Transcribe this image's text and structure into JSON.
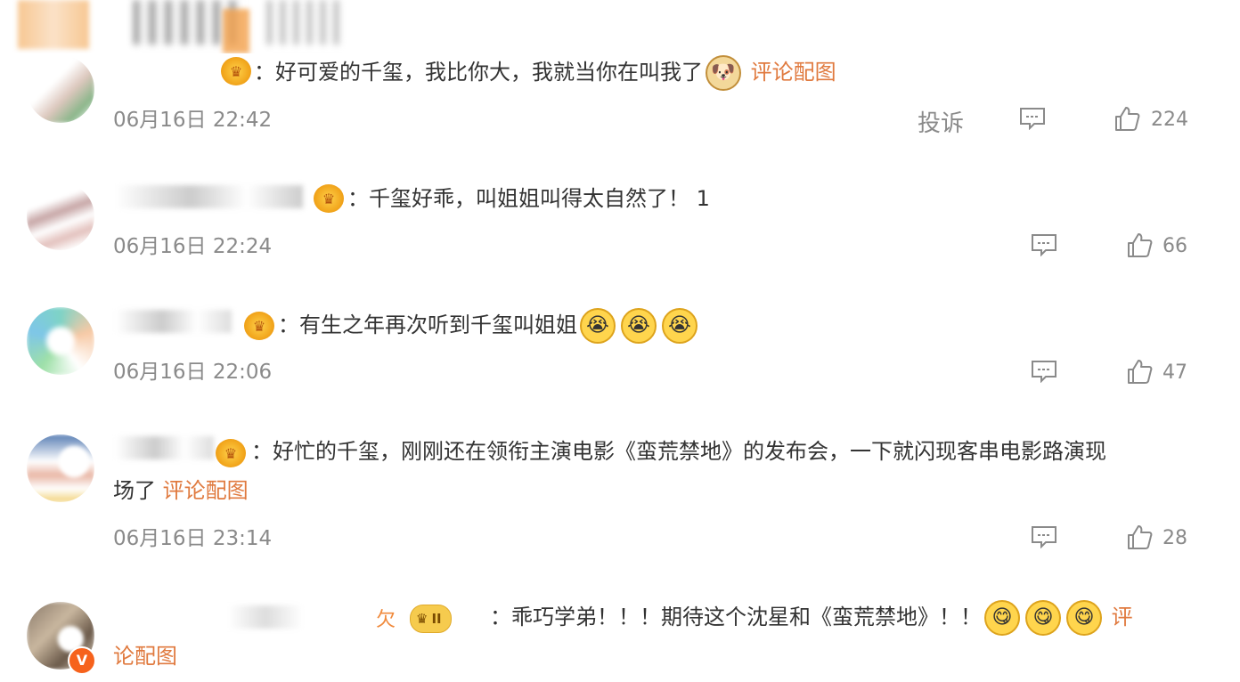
{
  "comments": [
    {
      "text": "：好可爱的千玺，我比你大，我就当你在叫我了",
      "link": "评论配图",
      "time": "06月16日 22:42",
      "report": "投诉",
      "likes": "224",
      "emojis": [
        "doge-icon"
      ]
    },
    {
      "text": "：千玺好乖，叫姐姐叫得太自然了！ 1",
      "time": "06月16日 22:24",
      "likes": "66"
    },
    {
      "text": "：有生之年再次听到千玺叫姐姐",
      "time": "06月16日 22:06",
      "likes": "47",
      "emojis": [
        "crying-icon",
        "crying-icon",
        "crying-icon"
      ]
    },
    {
      "text_line1": "：好忙的千玺，刚刚还在领衔主演电影《蛮荒禁地》的发布会，一下就闪现客串电影路演现",
      "text_line2": "场了",
      "link": "评论配图",
      "time": "06月16日 23:14",
      "likes": "28"
    },
    {
      "username_tail": "欠",
      "vip_level": "II",
      "text": "：乖巧学弟！！！期待这个沈星和《蛮荒禁地》！！",
      "link_part1": "评",
      "link_part2": "论配图",
      "emojis": [
        "tongue-out-icon",
        "tongue-out-icon",
        "tongue-out-icon"
      ]
    }
  ],
  "colors": {
    "link": "#e07a3f",
    "meta": "#8a8a8a",
    "text": "#333333"
  }
}
